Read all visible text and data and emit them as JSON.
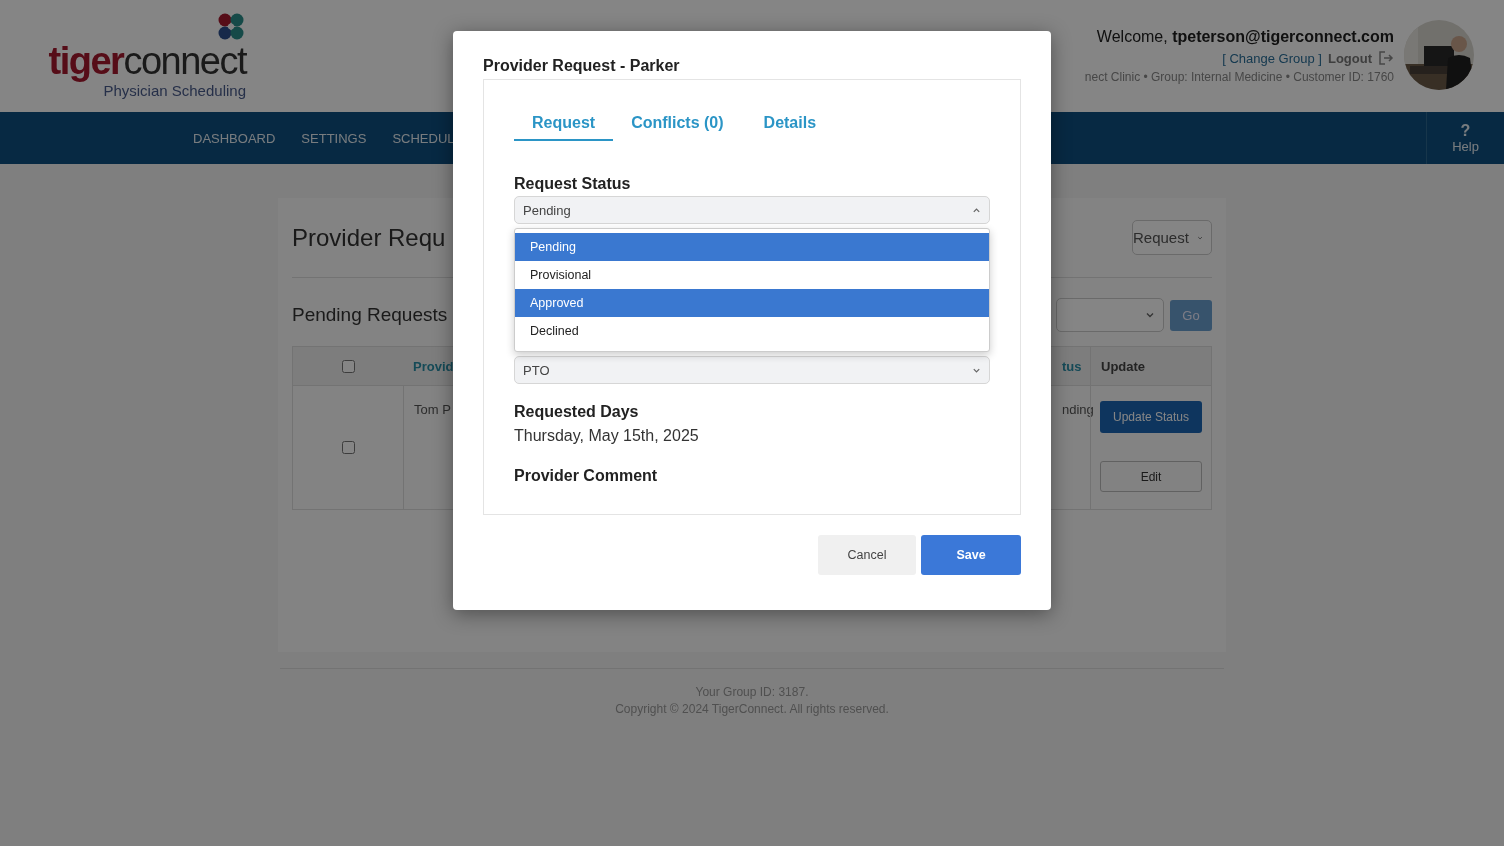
{
  "header": {
    "logo": {
      "brand_bold": "tiger",
      "brand_light": "connect",
      "tagline": "Physician Scheduling"
    },
    "welcome": "Welcome, **tpeterson@tigerconnect.com**",
    "change_group": "[ Change Group ]",
    "logout": "Logout",
    "info": "nect Clinic • Group: Internal Medicine • Customer ID: 1760"
  },
  "nav": {
    "items": [
      {
        "label": "DASHBOARD"
      },
      {
        "label": "SETTINGS"
      },
      {
        "label": "SCHEDUL"
      }
    ],
    "help": {
      "icon": "?",
      "label": "Help"
    }
  },
  "page": {
    "title": "Provider Requ",
    "view_select": "Request",
    "section_title": "Pending Requests",
    "go_button": "Go",
    "table": {
      "columns": [
        {
          "kind": "checkbox",
          "checked": false
        },
        {
          "kind": "text",
          "label": "Provid"
        },
        {
          "kind": "text",
          "label": "tus"
        },
        {
          "kind": "plain",
          "label": "Update"
        }
      ],
      "rows": [
        {
          "checked": false,
          "provider": "Tom P",
          "status": "nding",
          "update_button": "Update Status",
          "edit_button": "Edit"
        }
      ]
    }
  },
  "footer": {
    "group_id": "Your Group ID: 3187.",
    "copyright": "Copyright © 2024 TigerConnect. All rights reserved."
  },
  "modal": {
    "title": "Provider Request - Parker",
    "tabs": [
      {
        "label": "Request",
        "selected": true
      },
      {
        "label": "Conflicts (0)",
        "selected": false
      },
      {
        "label": "Details",
        "selected": false
      }
    ],
    "status_label": "Request Status",
    "status_value": "Pending",
    "status_open": true,
    "status_options": [
      {
        "label": "Pending",
        "highlighted": true
      },
      {
        "label": "Provisional",
        "highlighted": false
      },
      {
        "label": "Approved",
        "highlighted": true
      },
      {
        "label": "Declined",
        "highlighted": false
      }
    ],
    "type_value": "PTO",
    "days_label": "Requested Days",
    "days_value": "Thursday, May 15th, 2025",
    "comment_label": "Provider Comment",
    "buttons": [
      {
        "label": "Cancel",
        "kind": "secondary"
      },
      {
        "label": "Save",
        "kind": "primary"
      }
    ]
  }
}
